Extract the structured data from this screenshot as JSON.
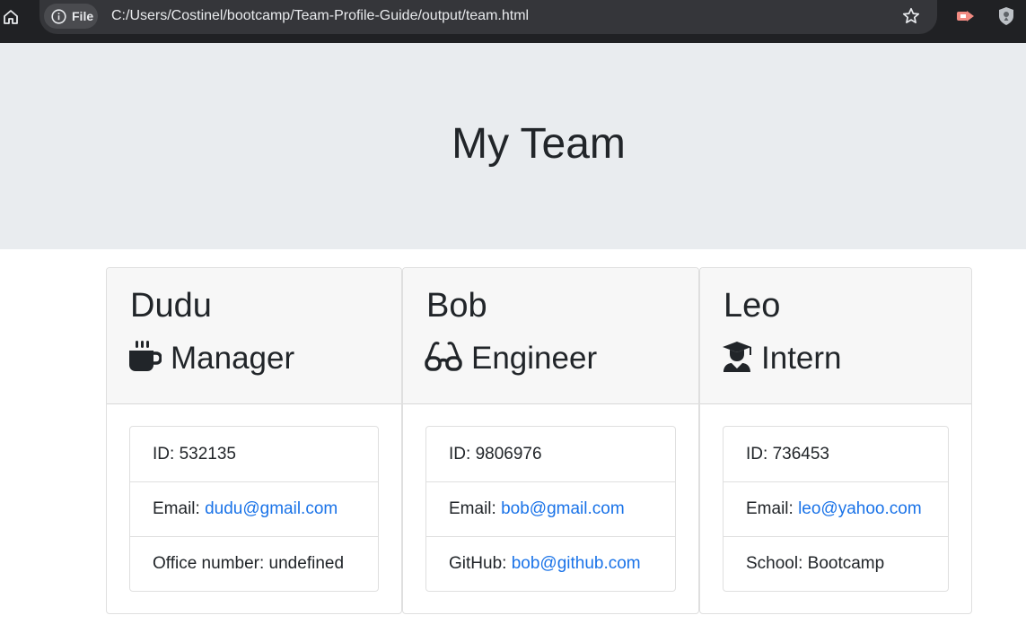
{
  "browser": {
    "file_label": "File",
    "url": "C:/Users/Costinel/bootcamp/Team-Profile-Guide/output/team.html",
    "icons": [
      "home-icon",
      "info-icon",
      "star-icon",
      "extension-icon",
      "location-shield-icon"
    ]
  },
  "page": {
    "title": "My Team"
  },
  "team": [
    {
      "name": "Dudu",
      "role": "Manager",
      "role_icon": "mug-icon",
      "id_label": "ID:",
      "id": "532135",
      "email_label": "Email:",
      "email": "dudu@gmail.com",
      "extra_label": "Office number:",
      "extra_value": "undefined"
    },
    {
      "name": "Bob",
      "role": "Engineer",
      "role_icon": "glasses-icon",
      "id_label": "ID:",
      "id": "9806976",
      "email_label": "Email:",
      "email": "bob@gmail.com",
      "extra_label": "GitHub:",
      "extra_value": "bob@github.com"
    },
    {
      "name": "Leo",
      "role": "Intern",
      "role_icon": "graduate-icon",
      "id_label": "ID:",
      "id": "736453",
      "email_label": "Email:",
      "email": "leo@yahoo.com",
      "extra_label": "School:",
      "extra_value": "Bootcamp"
    }
  ],
  "colors": {
    "jumbotron_bg": "#e9ecef",
    "card_header_bg": "#f7f7f7",
    "link": "#1a73e8",
    "browser_bar": "#202124"
  }
}
